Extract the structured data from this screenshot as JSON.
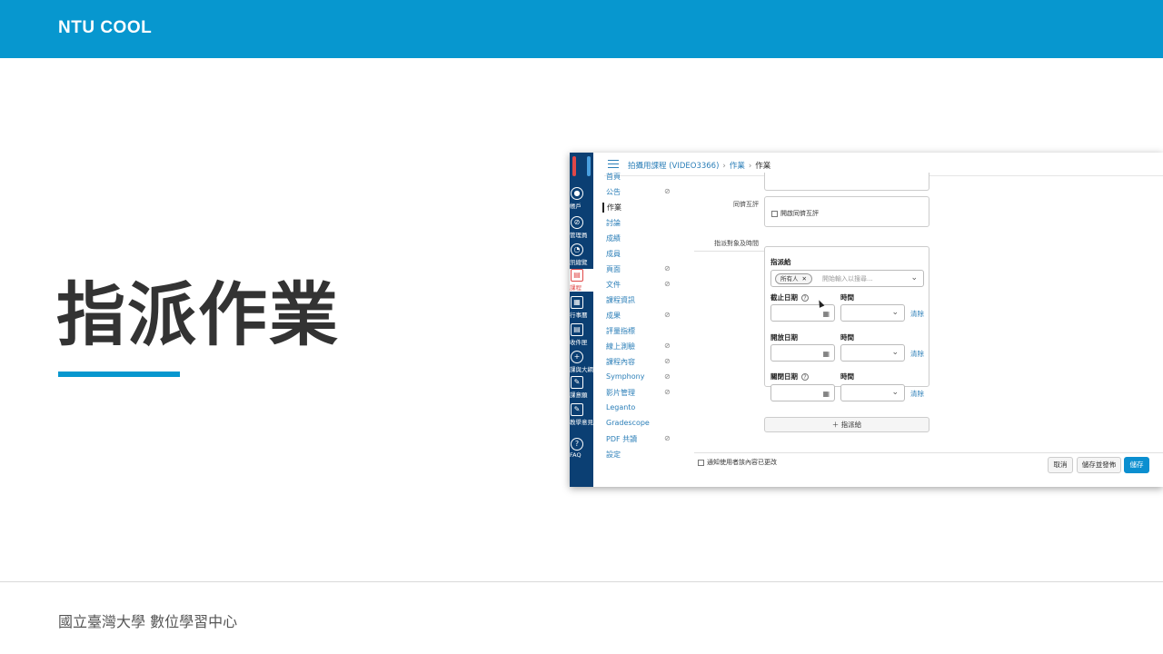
{
  "header": {
    "brand": "NTU COOL"
  },
  "slide": {
    "title": "指派作業"
  },
  "footer": {
    "text": "國立臺灣大學 數位學習中心"
  },
  "colors": {
    "brand": "#0797cf",
    "nav": "#0b3f73",
    "accent": "#e04848",
    "link": "#2c7fb8",
    "primary_button": "#0b8fd0"
  },
  "screenshot": {
    "breadcrumb": {
      "course": "拍攝用課程 (VIDEO3366)",
      "section": "作業",
      "current": "作業",
      "sep": "›"
    },
    "global_nav": [
      {
        "icon": "user-icon",
        "label": "帳戶"
      },
      {
        "icon": "admin-icon",
        "label": "管理員"
      },
      {
        "icon": "dashboard-icon",
        "label": "訊總覽"
      },
      {
        "icon": "course-icon",
        "label": "課程"
      },
      {
        "icon": "calendar-icon",
        "label": "行事曆"
      },
      {
        "icon": "inbox-icon",
        "label": "收件匣"
      },
      {
        "icon": "plus-icon",
        "label": "課與大綱"
      },
      {
        "icon": "edit-icon",
        "label": "課意願"
      },
      {
        "icon": "edit-icon",
        "label": "教學意見調查"
      },
      {
        "icon": "help-icon",
        "label": "FAQ"
      }
    ],
    "course_nav": [
      {
        "label": "首頁",
        "eye": false
      },
      {
        "label": "公告",
        "eye": true
      },
      {
        "label": "作業",
        "eye": false
      },
      {
        "label": "討論",
        "eye": false
      },
      {
        "label": "成績",
        "eye": false
      },
      {
        "label": "成員",
        "eye": false
      },
      {
        "label": "頁面",
        "eye": true
      },
      {
        "label": "文件",
        "eye": true
      },
      {
        "label": "課程資訊",
        "eye": false
      },
      {
        "label": "成果",
        "eye": true
      },
      {
        "label": "評量指標",
        "eye": false
      },
      {
        "label": "線上測驗",
        "eye": true
      },
      {
        "label": "課程內容",
        "eye": true
      },
      {
        "label": "Symphony",
        "eye": true
      },
      {
        "label": "影片管理",
        "eye": true
      },
      {
        "label": "Leganto",
        "eye": false
      },
      {
        "label": "Gradescope",
        "eye": false
      },
      {
        "label": "PDF 共讀",
        "eye": true
      },
      {
        "label": "設定",
        "eye": false
      }
    ],
    "eye_glyph": "⊘",
    "form": {
      "peer_review_label": "同儕互評",
      "peer_review_checkbox": "開啟同儕互評",
      "assign_section_label": "指派對象及時間",
      "assign_to_label": "指派給",
      "assignee_tag": "所有人",
      "tag_remove": "✕",
      "assignee_placeholder": "開始輸入以搜尋...",
      "due_label": "截止日期",
      "available_from_label": "開放日期",
      "until_label": "關閉日期",
      "time_label": "時間",
      "clear": "清除",
      "help": "?",
      "add_assign": "＋ 指派給"
    },
    "notify_checkbox": "通知使用者該內容已更改",
    "buttons": {
      "cancel": "取消",
      "save_publish": "儲存並發佈",
      "save": "儲存"
    }
  }
}
